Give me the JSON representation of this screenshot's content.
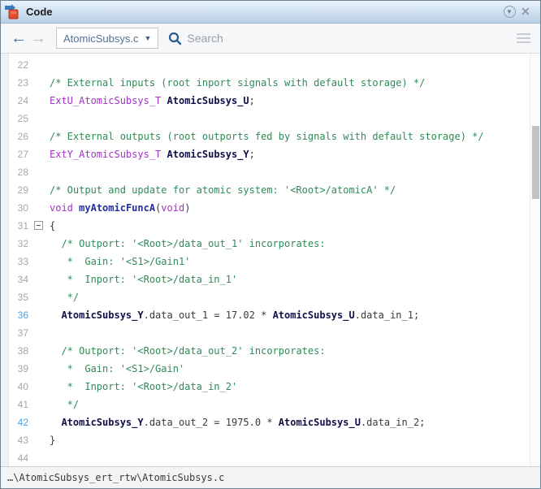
{
  "titlebar": {
    "title": "Code",
    "icons": {
      "app": "simulink-code-icon",
      "pin": "dock-menu-icon",
      "close": "close-icon"
    }
  },
  "toolbar": {
    "back_label": "←",
    "forward_label": "→",
    "file_selector": {
      "value": "AtomicSubsys.c",
      "caret": "▼"
    },
    "search": {
      "placeholder": "Search"
    }
  },
  "editor": {
    "highlighted_line_numbers": [
      36,
      42
    ],
    "fold_line_number": 31,
    "lines": [
      {
        "n": 22,
        "t": []
      },
      {
        "n": 23,
        "t": [
          [
            "c",
            "/* External inputs (root inport signals with default storage) */"
          ]
        ]
      },
      {
        "n": 24,
        "t": [
          [
            "k",
            "ExtU_AtomicSubsys_T"
          ],
          [
            "p",
            " "
          ],
          [
            "v",
            "AtomicSubsys_U"
          ],
          [
            "p",
            ";"
          ]
        ]
      },
      {
        "n": 25,
        "t": []
      },
      {
        "n": 26,
        "t": [
          [
            "c",
            "/* External outputs (root outports fed by signals with default storage) */"
          ]
        ]
      },
      {
        "n": 27,
        "t": [
          [
            "k",
            "ExtY_AtomicSubsys_T"
          ],
          [
            "p",
            " "
          ],
          [
            "v",
            "AtomicSubsys_Y"
          ],
          [
            "p",
            ";"
          ]
        ]
      },
      {
        "n": 28,
        "t": []
      },
      {
        "n": 29,
        "t": [
          [
            "c",
            "/* Output and update for atomic system: '<Root>/atomicA' */"
          ]
        ]
      },
      {
        "n": 30,
        "t": [
          [
            "k",
            "void"
          ],
          [
            "p",
            " "
          ],
          [
            "f",
            "myAtomicFuncA"
          ],
          [
            "p",
            "("
          ],
          [
            "k",
            "void"
          ],
          [
            "p",
            ")"
          ]
        ]
      },
      {
        "n": 31,
        "fold": true,
        "t": [
          [
            "p",
            "{"
          ]
        ]
      },
      {
        "n": 32,
        "t": [
          [
            "p",
            "  "
          ],
          [
            "c",
            "/* Outport: '<Root>/data_out_1' incorporates:"
          ]
        ]
      },
      {
        "n": 33,
        "t": [
          [
            "p",
            "  "
          ],
          [
            "c",
            " *  Gain: '<S1>/Gain1'"
          ]
        ]
      },
      {
        "n": 34,
        "t": [
          [
            "p",
            "  "
          ],
          [
            "c",
            " *  Inport: '<Root>/data_in_1'"
          ]
        ]
      },
      {
        "n": 35,
        "t": [
          [
            "p",
            "  "
          ],
          [
            "c",
            " */"
          ]
        ]
      },
      {
        "n": 36,
        "hl": true,
        "t": [
          [
            "p",
            "  "
          ],
          [
            "v",
            "AtomicSubsys_Y"
          ],
          [
            "p",
            ".data_out_1 = 17.02 * "
          ],
          [
            "v",
            "AtomicSubsys_U"
          ],
          [
            "p",
            ".data_in_1;"
          ]
        ]
      },
      {
        "n": 37,
        "t": []
      },
      {
        "n": 38,
        "t": [
          [
            "p",
            "  "
          ],
          [
            "c",
            "/* Outport: '<Root>/data_out_2' incorporates:"
          ]
        ]
      },
      {
        "n": 39,
        "t": [
          [
            "p",
            "  "
          ],
          [
            "c",
            " *  Gain: '<S1>/Gain'"
          ]
        ]
      },
      {
        "n": 40,
        "t": [
          [
            "p",
            "  "
          ],
          [
            "c",
            " *  Inport: '<Root>/data_in_2'"
          ]
        ]
      },
      {
        "n": 41,
        "t": [
          [
            "p",
            "  "
          ],
          [
            "c",
            " */"
          ]
        ]
      },
      {
        "n": 42,
        "hl": true,
        "t": [
          [
            "p",
            "  "
          ],
          [
            "v",
            "AtomicSubsys_Y"
          ],
          [
            "p",
            ".data_out_2 = 1975.0 * "
          ],
          [
            "v",
            "AtomicSubsys_U"
          ],
          [
            "p",
            ".data_in_2;"
          ]
        ]
      },
      {
        "n": 43,
        "t": [
          [
            "p",
            "}"
          ]
        ]
      },
      {
        "n": 44,
        "t": []
      }
    ]
  },
  "statusbar": {
    "path": "…\\AtomicSubsys_ert_rtw\\AtomicSubsys.c"
  },
  "colors": {
    "comment": "#2e8b57",
    "keyword": "#a233c8",
    "function_name": "#23309c",
    "variable": "#101049",
    "line_number": "#a6a6a6",
    "line_number_highlight": "#4aa3e8",
    "titlebar_gradient_top": "#eaf4fd",
    "titlebar_gradient_bottom": "#b9cfe4",
    "toolbar_bg": "#f6f7f8"
  }
}
